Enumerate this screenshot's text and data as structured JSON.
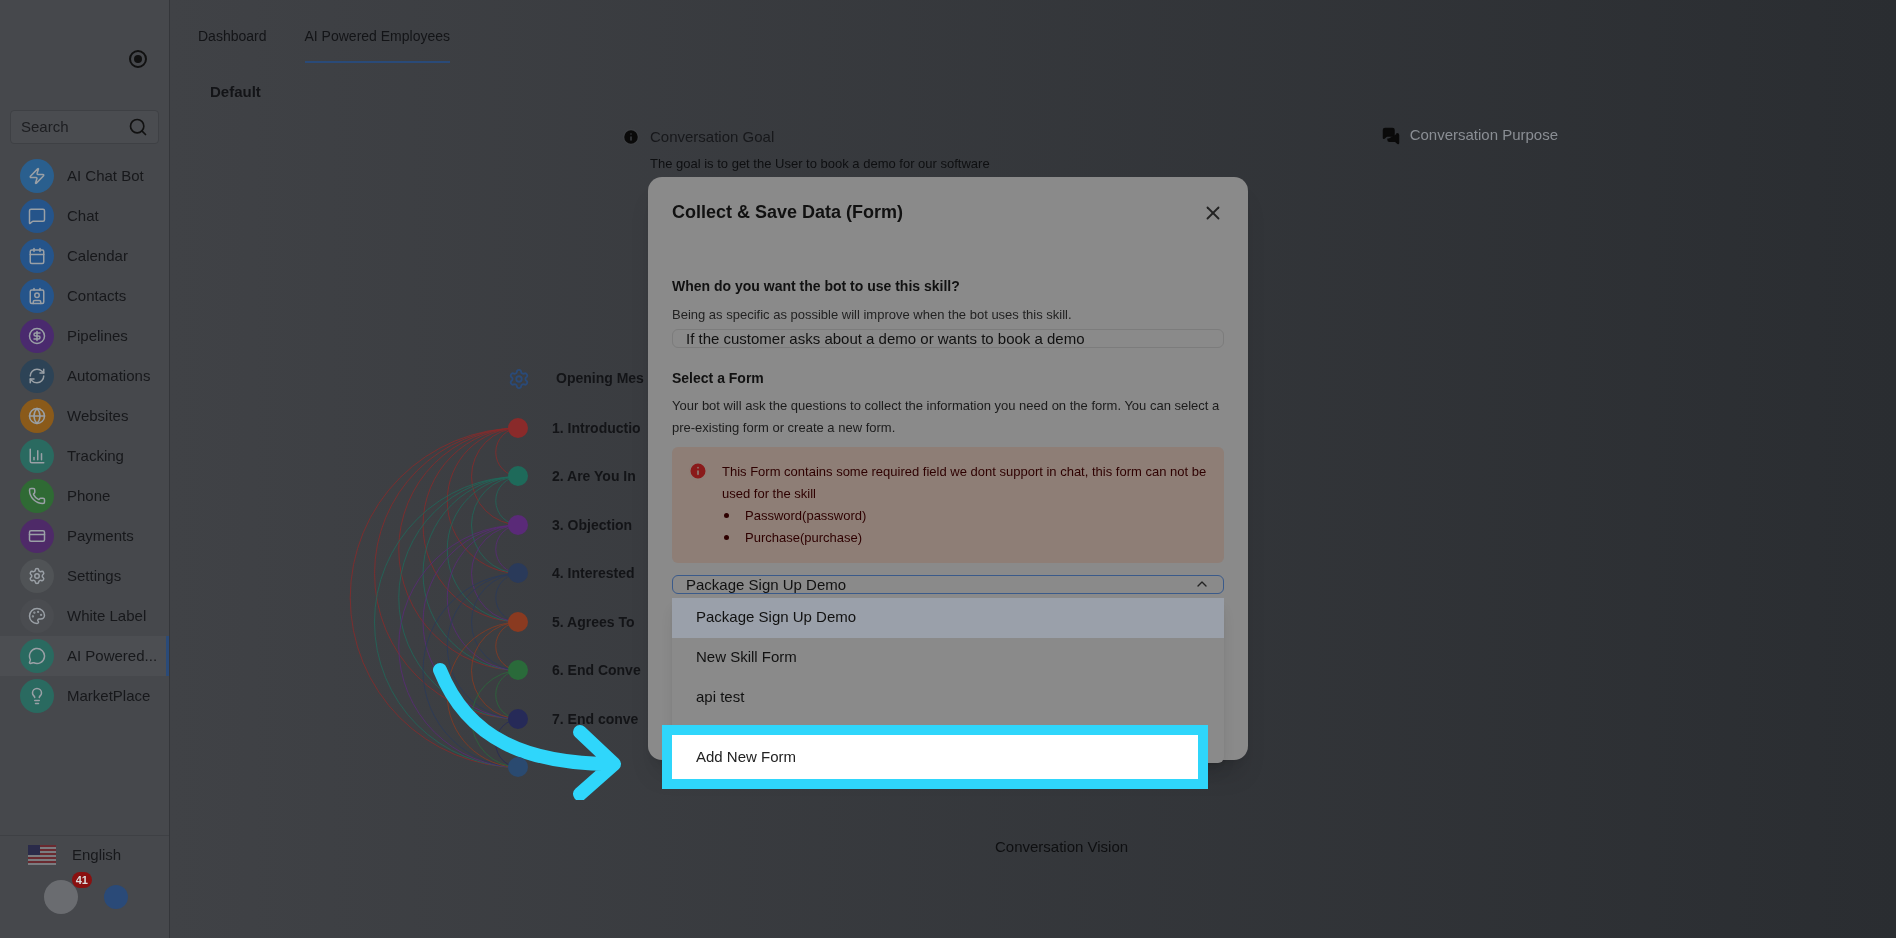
{
  "tabs": [
    {
      "label": "Dashboard",
      "selected": false
    },
    {
      "label": "AI Powered Employees",
      "selected": true
    }
  ],
  "subtab": "Default",
  "sidebar": {
    "search": {
      "placeholder": "Search"
    },
    "items": [
      {
        "label": "AI Chat Bot",
        "color": "#2a5f8e",
        "selected": false
      },
      {
        "label": "Chat",
        "color": "#25548a",
        "selected": false
      },
      {
        "label": "Calendar",
        "color": "#25548a",
        "selected": false
      },
      {
        "label": "Contacts",
        "color": "#25548a",
        "selected": false
      },
      {
        "label": "Pipelines",
        "color": "#4a2a6e",
        "selected": false
      },
      {
        "label": "Automations",
        "color": "#2d4356",
        "selected": false
      },
      {
        "label": "Websites",
        "color": "#8a5a1a",
        "selected": false
      },
      {
        "label": "Tracking",
        "color": "#2a6a60",
        "selected": false
      },
      {
        "label": "Phone",
        "color": "#2f6a34",
        "selected": false
      },
      {
        "label": "Payments",
        "color": "#4e2a68",
        "selected": false
      },
      {
        "label": "Settings",
        "color": "#505356",
        "selected": false
      },
      {
        "label": "White Label",
        "color": "#4a4c50",
        "selected": false
      },
      {
        "label": "AI Powered...",
        "color": "#2a6a60",
        "selected": true
      },
      {
        "label": "MarketPlace",
        "color": "#2a6a60",
        "selected": false
      }
    ],
    "language": "English",
    "badge": "41"
  },
  "goal": {
    "title": "Conversation Goal",
    "text": "The goal is to get the User to book a demo for our software"
  },
  "purpose": {
    "title": "Conversation Purpose"
  },
  "flow": {
    "title": "Opening Mes",
    "stages": [
      {
        "label": "1. Introductio",
        "color": "#8a2a2a"
      },
      {
        "label": "2. Are You In",
        "color": "#1e6a5a"
      },
      {
        "label": "3. Objection",
        "color": "#5a2a78"
      },
      {
        "label": "4. Interested",
        "color": "#2a3a5a"
      },
      {
        "label": "5. Agrees To",
        "color": "#8a3a20"
      },
      {
        "label": "6. End Conve",
        "color": "#2a6a3a"
      },
      {
        "label": "7. End conve",
        "color": "#262a58"
      },
      {
        "color": "#2a4a70"
      }
    ]
  },
  "vision": {
    "title": "Conversation Vision"
  },
  "modal": {
    "title": "Collect & Save Data (Form)",
    "question": "When do you want the bot to use this skill?",
    "question_hint": "Being as specific as possible will improve when the bot uses this skill.",
    "trigger": "If the customer asks about a demo or wants to book a demo",
    "form_label": "Select a Form",
    "form_hint": "Your bot will ask the questions to collect the information you need on the form. You can select a pre-existing form or create a new form.",
    "alert": {
      "text": "This Form contains some required field we dont support in chat, this form can not be used for the skill",
      "items": [
        "Password(password)",
        "Purchase(purchase)"
      ]
    },
    "select": {
      "value": "Package Sign Up Demo",
      "expanded": true
    },
    "options": [
      {
        "label": "Package Sign Up Demo",
        "selected": true,
        "highlighted": false
      },
      {
        "label": "New Skill Form",
        "selected": false,
        "highlighted": false
      },
      {
        "label": "api test",
        "selected": false,
        "highlighted": false
      },
      {
        "label": "Add New Form",
        "selected": false,
        "highlighted": true
      }
    ]
  }
}
